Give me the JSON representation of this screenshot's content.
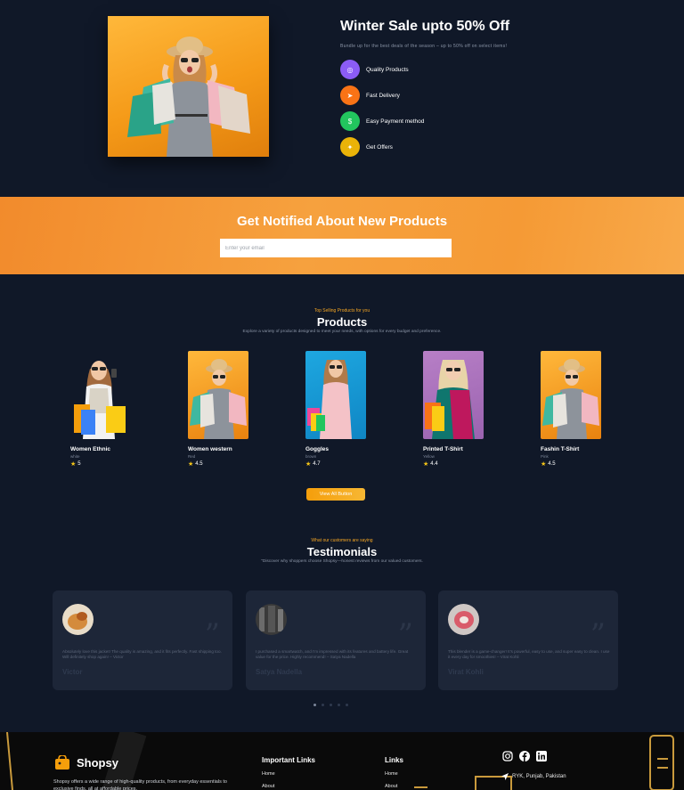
{
  "sale": {
    "title": "Winter Sale upto 50% Off",
    "description": "Bundle up for the best deals of the season – up to 50% off on select items!",
    "features": [
      {
        "label": "Quality Products",
        "icon": "badge-icon",
        "color": "#8b5cf6"
      },
      {
        "label": "Fast Delivery",
        "icon": "truck-icon",
        "color": "#f97316"
      },
      {
        "label": "Easy Payment method",
        "icon": "wallet-icon",
        "color": "#22c55e"
      },
      {
        "label": "Get Offers",
        "icon": "gift-icon",
        "color": "#eab308"
      }
    ]
  },
  "notify": {
    "title": "Get Notified About New Products",
    "email_placeholder": "Enter your email"
  },
  "products": {
    "subtitle": "Top Selling Products for you",
    "title": "Products",
    "description": "Explore a variety of products designed to meet your needs, with options for every budget and preference.",
    "items": [
      {
        "name": "Women Ethnic",
        "color": "white",
        "rating": "5"
      },
      {
        "name": "Women western",
        "color": "Red",
        "rating": "4.5"
      },
      {
        "name": "Goggles",
        "color": "brown",
        "rating": "4.7"
      },
      {
        "name": "Printed T-Shirt",
        "color": "Yellow",
        "rating": "4.4"
      },
      {
        "name": "Fashin T-Shirt",
        "color": "Pink",
        "rating": "4.5"
      }
    ],
    "view_all": "View All Button"
  },
  "testimonials": {
    "subtitle": "What our customers are saying",
    "title": "Testimonials",
    "description": "\"Discover why shoppers choose Shopsy—honest reviews from our valued customers.",
    "items": [
      {
        "text": "Absolutely love this jacket! The quality is amazing, and it fits perfectly. Fast shipping too. Will definitely shop again! – Victor",
        "name": "Victor"
      },
      {
        "text": "I purchased a smartwatch, and I'm impressed with its features and battery life. Great value for the price. Highly recommend! – Satya Nadella",
        "name": "Satya Nadella"
      },
      {
        "text": "This blender is a game-changer! It's powerful, easy to use, and super easy to clean. I use it every day for smoothies! – Virat Kohli",
        "name": "Virat Kohli"
      }
    ]
  },
  "footer": {
    "brand": "Shopsy",
    "description": "Shopsy offers a wide range of high-quality products, from everyday essentials to exclusive finds, all at affordable prices.",
    "important_links_title": "Important Links",
    "important_links": [
      "Home",
      "About"
    ],
    "links_title": "Links",
    "links": [
      "Home",
      "About"
    ],
    "address": "RYK, Punjab, Pakistan"
  }
}
